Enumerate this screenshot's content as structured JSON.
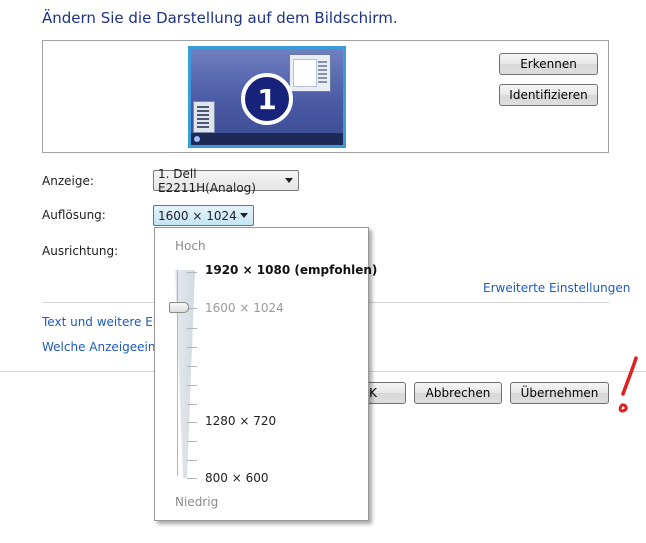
{
  "page": {
    "title": "Ändern Sie die Darstellung auf dem Bildschirm."
  },
  "preview": {
    "monitor_number": "1",
    "detect_label": "Erkennen",
    "identify_label": "Identifizieren"
  },
  "form": {
    "display_label": "Anzeige:",
    "display_value": "1. Dell E2211H(Analog)",
    "resolution_label": "Auflösung:",
    "resolution_value": "1600 × 1024",
    "orientation_label": "Ausrichtung:"
  },
  "links": {
    "advanced": "Erweiterte Einstellungen",
    "text_size": "Text und weitere Elemente",
    "which_settings": "Welche Anzeigeeinstellungen"
  },
  "buttons": {
    "ok": "K",
    "cancel": "Abbrechen",
    "apply": "Übernehmen"
  },
  "resolution_dropdown": {
    "high_label": "Hoch",
    "low_label": "Niedrig",
    "items": [
      {
        "label": "1920 × 1080 (empfohlen)",
        "state": "recommended"
      },
      {
        "label": "1600 × 1024",
        "state": "selected"
      },
      {
        "label": "1280 × 720",
        "state": "normal"
      },
      {
        "label": "800 × 600",
        "state": "normal"
      }
    ]
  },
  "annotation": {
    "color": "#e02020",
    "text": "!"
  }
}
